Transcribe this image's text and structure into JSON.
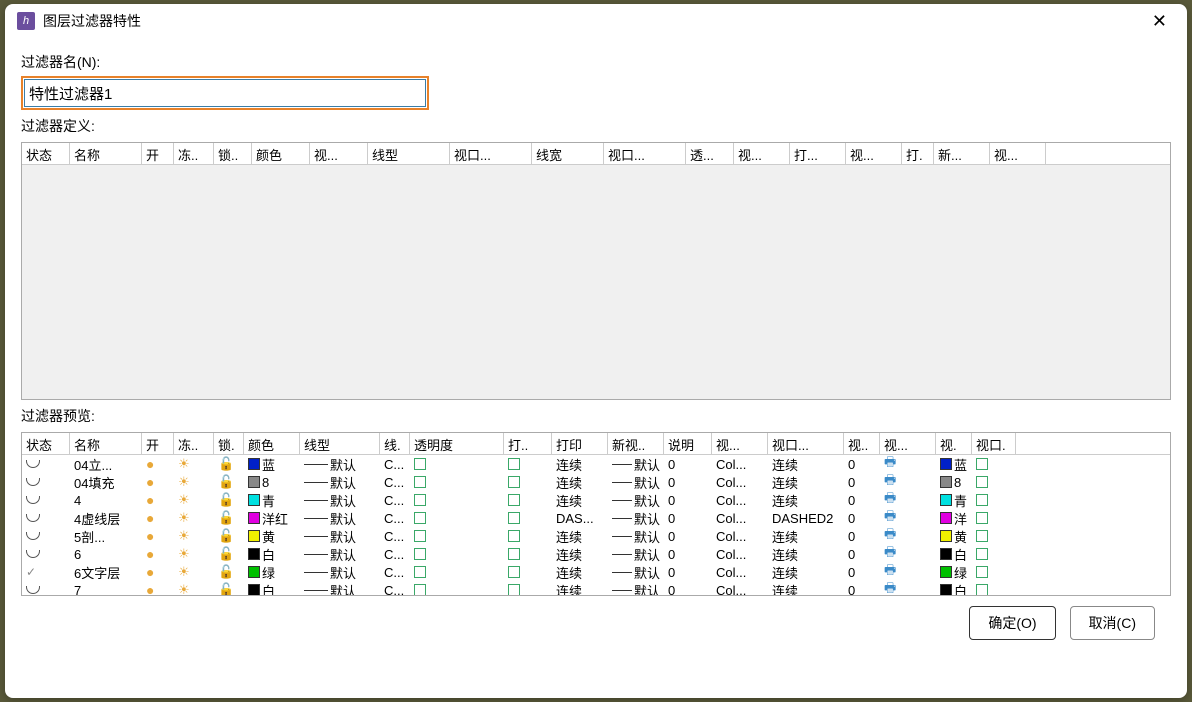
{
  "title": "图层过滤器特性",
  "labels": {
    "filter_name": "过滤器名(N):",
    "filter_def": "过滤器定义:",
    "filter_preview": "过滤器预览:"
  },
  "filter_name_value": "特性过滤器1",
  "def_columns": [
    "状态",
    "名称",
    "开",
    "冻..",
    "锁..",
    "颜色",
    "视...",
    "线型",
    "视口...",
    "线宽",
    "视口...",
    "透...",
    "视...",
    "打...",
    "视...",
    "打.",
    "新...",
    "视..."
  ],
  "def_widths": [
    48,
    72,
    32,
    40,
    38,
    58,
    58,
    82,
    82,
    72,
    82,
    48,
    56,
    56,
    56,
    32,
    56,
    56
  ],
  "preview_columns": [
    "状态",
    "名称",
    "开",
    "冻..",
    "锁.",
    "颜色",
    "线型",
    "线.",
    "透明度",
    "打..",
    "打印",
    "新视..",
    "说明",
    "视...",
    "视口...",
    "视..",
    "视...",
    "视.",
    "视口."
  ],
  "preview_widths": [
    48,
    72,
    32,
    40,
    30,
    56,
    80,
    30,
    94,
    48,
    56,
    56,
    48,
    56,
    76,
    36,
    56,
    36,
    44
  ],
  "preview_rows": [
    {
      "status": "layer",
      "name": "04立...",
      "color_hex": "#0020c8",
      "color_name": "蓝",
      "linetype": "默认",
      "lw": "C...",
      "trans": "",
      "print": "连续",
      "np": "默认",
      "desc": "0",
      "vp1": "Col...",
      "vp2": "连续",
      "vp3": "0",
      "vp_color_hex": "#0020c8",
      "vp_color_name": "蓝"
    },
    {
      "status": "layer",
      "name": "04填充",
      "color_hex": "#888888",
      "color_name": "8",
      "linetype": "默认",
      "lw": "C...",
      "trans": "",
      "print": "连续",
      "np": "默认",
      "desc": "0",
      "vp1": "Col...",
      "vp2": "连续",
      "vp3": "0",
      "vp_color_hex": "#888888",
      "vp_color_name": "8"
    },
    {
      "status": "layer",
      "name": "4",
      "color_hex": "#00e0e0",
      "color_name": "青",
      "linetype": "默认",
      "lw": "C...",
      "trans": "",
      "print": "连续",
      "np": "默认",
      "desc": "0",
      "vp1": "Col...",
      "vp2": "连续",
      "vp3": "0",
      "vp_color_hex": "#00e0e0",
      "vp_color_name": "青"
    },
    {
      "status": "layer",
      "name": "4虚线层",
      "color_hex": "#e000e0",
      "color_name": "洋红",
      "linetype": "默认",
      "lw": "C...",
      "trans": "",
      "print": "DAS...",
      "np": "默认",
      "desc": "0",
      "vp1": "Col...",
      "vp2": "DASHED2",
      "vp3": "0",
      "vp_color_hex": "#e000e0",
      "vp_color_name": "洋"
    },
    {
      "status": "layer",
      "name": "5剖...",
      "color_hex": "#f0f000",
      "color_name": "黄",
      "linetype": "默认",
      "lw": "C...",
      "trans": "",
      "print": "连续",
      "np": "默认",
      "desc": "0",
      "vp1": "Col...",
      "vp2": "连续",
      "vp3": "0",
      "vp_color_hex": "#f0f000",
      "vp_color_name": "黄"
    },
    {
      "status": "layer",
      "name": "6",
      "color_hex": "#000000",
      "color_name": "白",
      "linetype": "默认",
      "lw": "C...",
      "trans": "",
      "print": "连续",
      "np": "默认",
      "desc": "0",
      "vp1": "Col...",
      "vp2": "连续",
      "vp3": "0",
      "vp_color_hex": "#000000",
      "vp_color_name": "白"
    },
    {
      "status": "current",
      "name": "6文字层",
      "color_hex": "#00c000",
      "color_name": "绿",
      "linetype": "默认",
      "lw": "C...",
      "trans": "",
      "print": "连续",
      "np": "默认",
      "desc": "0",
      "vp1": "Col...",
      "vp2": "连续",
      "vp3": "0",
      "vp_color_hex": "#00c000",
      "vp_color_name": "绿"
    },
    {
      "status": "layer",
      "name": "7",
      "color_hex": "#000000",
      "color_name": "白",
      "linetype": "默认",
      "lw": "C...",
      "trans": "",
      "print": "连续",
      "np": "默认",
      "desc": "0",
      "vp1": "Col...",
      "vp2": "连续",
      "vp3": "0",
      "vp_color_hex": "#000000",
      "vp_color_name": "白"
    }
  ],
  "buttons": {
    "ok": "确定(O)",
    "cancel": "取消(C)"
  }
}
